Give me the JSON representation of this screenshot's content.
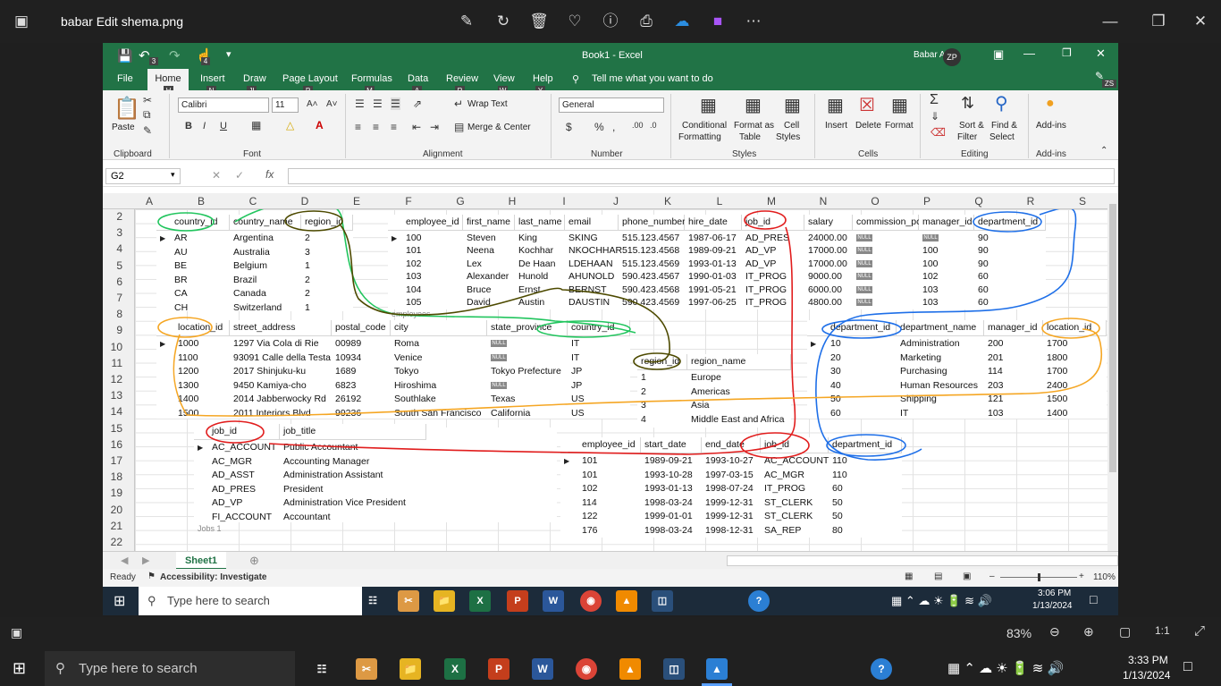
{
  "viewer": {
    "file_title": "babar Edit shema.png",
    "zoom": "83%"
  },
  "excel": {
    "title": "Book1  -  Excel",
    "user": "Babar A",
    "user_initials": "ZP",
    "help_initials": "ZS",
    "menu": {
      "file": "File",
      "home": "Home",
      "insert": "Insert",
      "draw": "Draw",
      "page_layout": "Page Layout",
      "formulas": "Formulas",
      "data": "Data",
      "review": "Review",
      "view": "View",
      "help": "Help",
      "tell_me": "Tell me what you want to do"
    },
    "keytips": {
      "home": "H",
      "insert": "N",
      "draw": "JI",
      "page_layout": "P",
      "formulas": "M",
      "data": "A",
      "review": "R",
      "view": "W",
      "help": "Y",
      "undo": "3",
      "redo": "4"
    },
    "ribbon": {
      "paste": "Paste",
      "clipboard": "Clipboard",
      "font_name": "Calibri",
      "font_size": "11",
      "font": "Font",
      "bold": "B",
      "italic": "I",
      "underline": "U",
      "wrap_text": "Wrap Text",
      "merge_center": "Merge & Center",
      "alignment": "Alignment",
      "number_format": "General",
      "number": "Number",
      "conditional_formatting_1": "Conditional",
      "conditional_formatting_2": "Formatting",
      "format_as_table_1": "Format as",
      "format_as_table_2": "Table",
      "cell_styles_1": "Cell",
      "cell_styles_2": "Styles",
      "styles": "Styles",
      "insert": "Insert",
      "delete": "Delete",
      "format": "Format",
      "cells": "Cells",
      "sort_filter_1": "Sort &",
      "sort_filter_2": "Filter",
      "find_select_1": "Find &",
      "find_select_2": "Select",
      "editing": "Editing",
      "add_ins": "Add-ins",
      "add_ins_group": "Add-ins"
    },
    "name_box": "G2",
    "columns": [
      "A",
      "B",
      "C",
      "D",
      "E",
      "F",
      "G",
      "H",
      "I",
      "J",
      "K",
      "L",
      "M",
      "N",
      "O",
      "P",
      "Q",
      "R",
      "S"
    ],
    "rows": [
      "2",
      "3",
      "4",
      "5",
      "6",
      "7",
      "8",
      "9",
      "10",
      "11",
      "12",
      "13",
      "14",
      "15",
      "16",
      "17",
      "18",
      "19",
      "20",
      "21",
      "22"
    ],
    "sheet_tab": "Sheet1",
    "status": {
      "ready": "Ready",
      "accessibility": "Accessibility: Investigate",
      "zoom": "110%"
    },
    "inner_taskbar": {
      "search": "Type here to search",
      "time": "3:06 PM",
      "date": "1/13/2024"
    }
  },
  "tables": {
    "countries": {
      "headers": [
        "country_id",
        "country_name",
        "region_id"
      ],
      "rows": [
        [
          "AR",
          "Argentina",
          "2"
        ],
        [
          "AU",
          "Australia",
          "3"
        ],
        [
          "BE",
          "Belgium",
          "1"
        ],
        [
          "BR",
          "Brazil",
          "2"
        ],
        [
          "CA",
          "Canada",
          "2"
        ],
        [
          "CH",
          "Switzerland",
          "1"
        ]
      ]
    },
    "employees": {
      "headers": [
        "employee_id",
        "first_name",
        "last_name",
        "email",
        "phone_number",
        "hire_date",
        "job_id",
        "salary",
        "commission_pct",
        "manager_id",
        "department_id"
      ],
      "rows": [
        [
          "100",
          "Steven",
          "King",
          "SKING",
          "515.123.4567",
          "1987-06-17",
          "AD_PRES",
          "24000.00",
          "NULL",
          "NULL",
          "90"
        ],
        [
          "101",
          "Neena",
          "Kochhar",
          "NKOCHHAR",
          "515.123.4568",
          "1989-09-21",
          "AD_VP",
          "17000.00",
          "NULL",
          "100",
          "90"
        ],
        [
          "102",
          "Lex",
          "De Haan",
          "LDEHAAN",
          "515.123.4569",
          "1993-01-13",
          "AD_VP",
          "17000.00",
          "NULL",
          "100",
          "90"
        ],
        [
          "103",
          "Alexander",
          "Hunold",
          "AHUNOLD",
          "590.423.4567",
          "1990-01-03",
          "IT_PROG",
          "9000.00",
          "NULL",
          "102",
          "60"
        ],
        [
          "104",
          "Bruce",
          "Ernst",
          "BERNST",
          "590.423.4568",
          "1991-05-21",
          "IT_PROG",
          "6000.00",
          "NULL",
          "103",
          "60"
        ],
        [
          "105",
          "David",
          "Austin",
          "DAUSTIN",
          "590.423.4569",
          "1997-06-25",
          "IT_PROG",
          "4800.00",
          "NULL",
          "103",
          "60"
        ]
      ],
      "sheet_tab_fragment": "employees"
    },
    "locations": {
      "headers": [
        "location_id",
        "street_address",
        "postal_code",
        "city",
        "state_province",
        "country_id"
      ],
      "rows": [
        [
          "1000",
          "1297 Via Cola di Rie",
          "00989",
          "Roma",
          "NULL",
          "IT"
        ],
        [
          "1100",
          "93091 Calle della Testa",
          "10934",
          "Venice",
          "NULL",
          "IT"
        ],
        [
          "1200",
          "2017 Shinjuku-ku",
          "1689",
          "Tokyo",
          "Tokyo Prefecture",
          "JP"
        ],
        [
          "1300",
          "9450 Kamiya-cho",
          "6823",
          "Hiroshima",
          "NULL",
          "JP"
        ],
        [
          "1400",
          "2014 Jabberwocky Rd",
          "26192",
          "Southlake",
          "Texas",
          "US"
        ],
        [
          "1500",
          "2011 Interiors Blvd",
          "99236",
          "South San Francisco",
          "California",
          "US"
        ]
      ]
    },
    "regions": {
      "headers": [
        "region_id",
        "region_name"
      ],
      "rows": [
        [
          "1",
          "Europe"
        ],
        [
          "2",
          "Americas"
        ],
        [
          "3",
          "Asia"
        ],
        [
          "4",
          "Middle East and Africa"
        ]
      ]
    },
    "departments": {
      "headers": [
        "department_id",
        "department_name",
        "manager_id",
        "location_id"
      ],
      "rows": [
        [
          "10",
          "Administration",
          "200",
          "1700"
        ],
        [
          "20",
          "Marketing",
          "201",
          "1800"
        ],
        [
          "30",
          "Purchasing",
          "114",
          "1700"
        ],
        [
          "40",
          "Human Resources",
          "203",
          "2400"
        ],
        [
          "50",
          "Shipping",
          "121",
          "1500"
        ],
        [
          "60",
          "IT",
          "103",
          "1400"
        ]
      ]
    },
    "jobs": {
      "headers": [
        "job_id",
        "job_title"
      ],
      "rows": [
        [
          "AC_ACCOUNT",
          "Public Accountant"
        ],
        [
          "AC_MGR",
          "Accounting Manager"
        ],
        [
          "AD_ASST",
          "Administration Assistant"
        ],
        [
          "AD_PRES",
          "President"
        ],
        [
          "AD_VP",
          "Administration Vice President"
        ],
        [
          "FI_ACCOUNT",
          "Accountant"
        ]
      ],
      "sheet_tab_fragment": "Jobs 1"
    },
    "job_history": {
      "headers": [
        "employee_id",
        "start_date",
        "end_date",
        "job_id",
        "department_id"
      ],
      "rows": [
        [
          "101",
          "1989-09-21",
          "1993-10-27",
          "AC_ACCOUNT",
          "110"
        ],
        [
          "101",
          "1993-10-28",
          "1997-03-15",
          "AC_MGR",
          "110"
        ],
        [
          "102",
          "1993-01-13",
          "1998-07-24",
          "IT_PROG",
          "60"
        ],
        [
          "114",
          "1998-03-24",
          "1999-12-31",
          "ST_CLERK",
          "50"
        ],
        [
          "122",
          "1999-01-01",
          "1999-12-31",
          "ST_CLERK",
          "50"
        ],
        [
          "176",
          "1998-03-24",
          "1998-12-31",
          "SA_REP",
          "80"
        ]
      ]
    }
  },
  "annotation_colors": {
    "green": "#22c55e",
    "olive": "#4d4a00",
    "red": "#e11d1d",
    "blue": "#1e6fe8",
    "orange": "#f5a623"
  },
  "taskbar": {
    "search": "Type here to search",
    "time": "3:33 PM",
    "date": "1/13/2024"
  }
}
